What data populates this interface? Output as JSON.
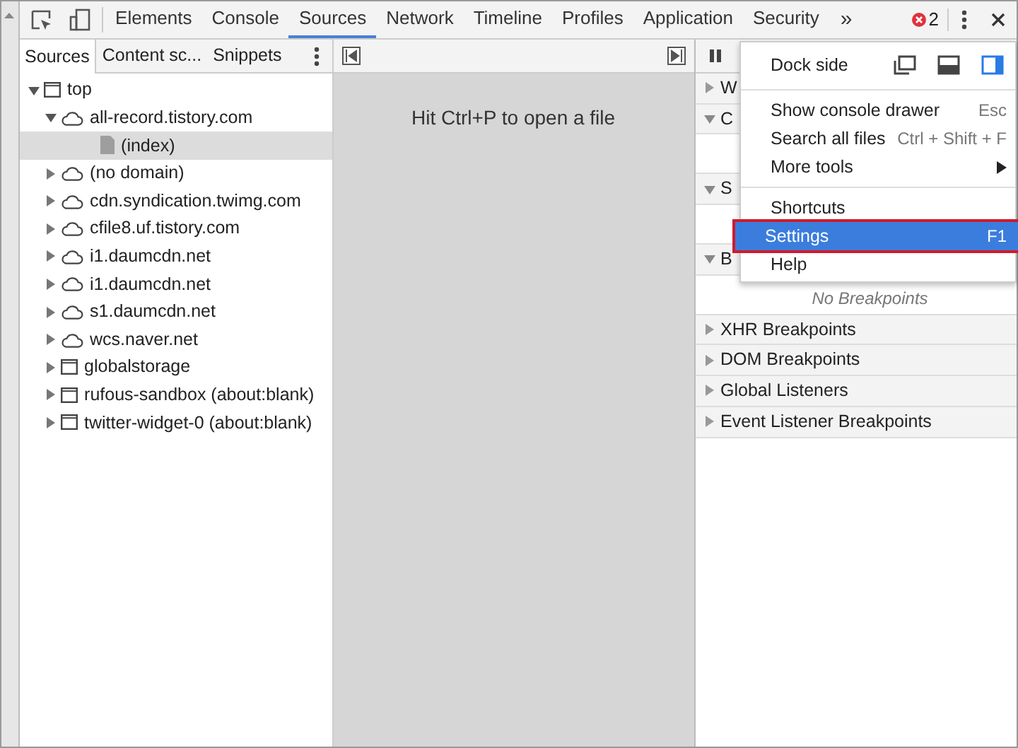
{
  "toolbar": {
    "tabs": [
      {
        "label": "Elements",
        "selected": false
      },
      {
        "label": "Console",
        "selected": false
      },
      {
        "label": "Sources",
        "selected": true
      },
      {
        "label": "Network",
        "selected": false
      },
      {
        "label": "Timeline",
        "selected": false
      },
      {
        "label": "Profiles",
        "selected": false
      },
      {
        "label": "Application",
        "selected": false
      },
      {
        "label": "Security",
        "selected": false
      }
    ],
    "overflow": "»",
    "error_count": "2"
  },
  "navigator": {
    "tabs": [
      {
        "label": "Sources",
        "selected": true
      },
      {
        "label": "Content sc...",
        "selected": false
      },
      {
        "label": "Snippets",
        "selected": false
      }
    ],
    "tree": [
      {
        "label": "top",
        "kind": "frame",
        "expanded": true,
        "selected": false,
        "children": [
          {
            "label": "all-record.tistory.com",
            "kind": "domain",
            "expanded": true,
            "selected": false,
            "children": [
              {
                "label": "(index)",
                "kind": "file",
                "selected": true
              }
            ]
          },
          {
            "label": "(no domain)",
            "kind": "domain",
            "expanded": false,
            "selected": false
          },
          {
            "label": "cdn.syndication.twimg.com",
            "kind": "domain",
            "expanded": false,
            "selected": false
          },
          {
            "label": "cfile8.uf.tistory.com",
            "kind": "domain",
            "expanded": false,
            "selected": false
          },
          {
            "label": "i1.daumcdn.net",
            "kind": "domain",
            "expanded": false,
            "selected": false
          },
          {
            "label": "i1.daumcdn.net",
            "kind": "domain",
            "expanded": false,
            "selected": false
          },
          {
            "label": "s1.daumcdn.net",
            "kind": "domain",
            "expanded": false,
            "selected": false
          },
          {
            "label": "wcs.naver.net",
            "kind": "domain",
            "expanded": false,
            "selected": false
          },
          {
            "label": "globalstorage",
            "kind": "frame",
            "expanded": false,
            "selected": false
          },
          {
            "label": "rufous-sandbox (about:blank)",
            "kind": "frame",
            "expanded": false,
            "selected": false
          },
          {
            "label": "twitter-widget-0 (about:blank)",
            "kind": "frame",
            "expanded": false,
            "selected": false
          }
        ]
      }
    ]
  },
  "editor": {
    "hint": "Hit Ctrl+P to open a file"
  },
  "debugger": {
    "sections": [
      {
        "title": "W",
        "expanded": false
      },
      {
        "title": "C",
        "expanded": true
      },
      {
        "title": "S",
        "expanded": true
      },
      {
        "title": "B",
        "expanded": true,
        "body": "No Breakpoints"
      },
      {
        "title": "XHR Breakpoints",
        "expanded": false
      },
      {
        "title": "DOM Breakpoints",
        "expanded": false
      },
      {
        "title": "Global Listeners",
        "expanded": false
      },
      {
        "title": "Event Listener Breakpoints",
        "expanded": false
      }
    ]
  },
  "menu": {
    "dock_side": {
      "label": "Dock side",
      "options": [
        {
          "kind": "undock",
          "selected": false
        },
        {
          "kind": "bottom",
          "selected": false
        },
        {
          "kind": "right",
          "selected": true
        }
      ]
    },
    "groups": [
      [
        {
          "label": "Show console drawer",
          "shortcut": "Esc",
          "submenu": false,
          "selected": false
        },
        {
          "label": "Search all files",
          "shortcut": "Ctrl + Shift + F",
          "submenu": false,
          "selected": false
        },
        {
          "label": "More tools",
          "submenu": true,
          "selected": false
        }
      ],
      [
        {
          "label": "Shortcuts",
          "submenu": false,
          "selected": false
        },
        {
          "label": "Settings",
          "shortcut": "F1",
          "submenu": false,
          "selected": true
        },
        {
          "label": "Help",
          "submenu": false,
          "selected": false
        }
      ]
    ]
  }
}
